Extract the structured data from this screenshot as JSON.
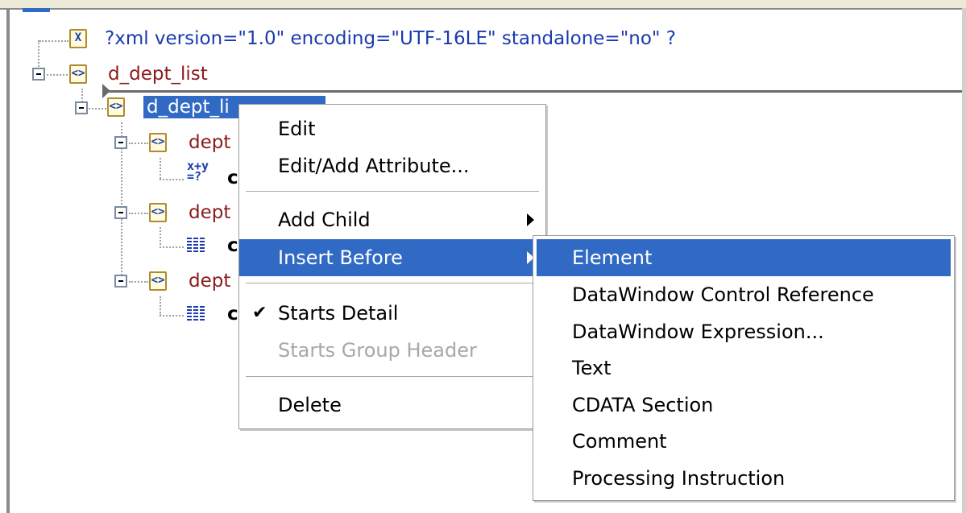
{
  "tree": {
    "xml_decl": "?xml version=\"1.0\" encoding=\"UTF-16LE\" standalone=\"no\" ?",
    "root": "d_dept_list",
    "selected_node": "d_dept_li",
    "child_label": "dept",
    "child_bold": "c"
  },
  "context_menu": {
    "edit": "Edit",
    "edit_add_attribute": "Edit/Add Attribute...",
    "add_child": "Add Child",
    "insert_before": "Insert Before",
    "starts_detail": "Starts Detail",
    "starts_group_header": "Starts Group Header",
    "delete": "Delete",
    "check_mark": "✔"
  },
  "submenu": {
    "items": [
      "Element",
      "DataWindow Control Reference",
      "DataWindow Expression...",
      "Text",
      "CDATA Section",
      "Comment",
      "Processing Instruction"
    ]
  },
  "icons": {
    "xml_decl_icon": "X",
    "element_icon": "<>",
    "expression_icon_top": "x+y",
    "expression_icon_bottom": "=?"
  },
  "colors": {
    "selection": "#316ac5",
    "element_text": "#8b1a1a",
    "declaration_text": "#1a3ab0"
  }
}
